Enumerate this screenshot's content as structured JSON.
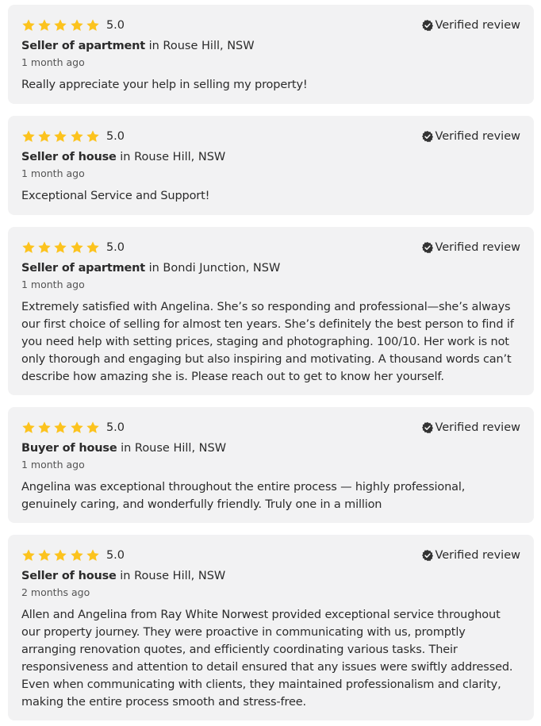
{
  "reviews": [
    {
      "rating": "5.0",
      "stars": 5,
      "verified_label": "Verified review",
      "role": "Seller of apartment",
      "location": "in Rouse Hill, NSW",
      "date": "1 month ago",
      "text": "Really appreciate your help in selling my property!"
    },
    {
      "rating": "5.0",
      "stars": 5,
      "verified_label": "Verified review",
      "role": "Seller of house",
      "location": "in Rouse Hill, NSW",
      "date": "1 month ago",
      "text": "Exceptional Service and Support!"
    },
    {
      "rating": "5.0",
      "stars": 5,
      "verified_label": "Verified review",
      "role": "Seller of apartment",
      "location": "in Bondi Junction, NSW",
      "date": "1 month ago",
      "text": "Extremely satisfied with Angelina. She’s so responding and professional—she’s always our first choice of selling for almost ten years. She’s definitely the best person to find if you need help with setting prices, staging and photographing. 100/10. Her work is not only thorough and engaging but also inspiring and motivating. A thousand words can’t describe how amazing she is. Please reach out to get to know her yourself."
    },
    {
      "rating": "5.0",
      "stars": 5,
      "verified_label": "Verified review",
      "role": "Buyer of house",
      "location": "in Rouse Hill, NSW",
      "date": "1 month ago",
      "text": "Angelina was exceptional throughout the entire process — highly professional, genuinely caring, and wonderfully friendly. Truly one in a million"
    },
    {
      "rating": "5.0",
      "stars": 5,
      "verified_label": "Verified review",
      "role": "Seller of house",
      "location": "in Rouse Hill, NSW",
      "date": "2 months ago",
      "text": "Allen and Angelina from Ray White Norwest provided exceptional service throughout our property journey. They were proactive in communicating with us, promptly arranging renovation quotes, and efficiently coordinating various tasks. Their responsiveness and attention to detail ensured that any issues were swiftly addressed. Even when communicating with clients, they maintained professionalism and clarity, making the entire process smooth and stress-free."
    }
  ],
  "colors": {
    "star": "#fcc31e",
    "card_bg": "#f2f2f3",
    "text": "#2b2b2b",
    "verified_icon": "#333333"
  },
  "icons": {
    "star": "star-icon",
    "verified": "verified-badge-icon"
  }
}
